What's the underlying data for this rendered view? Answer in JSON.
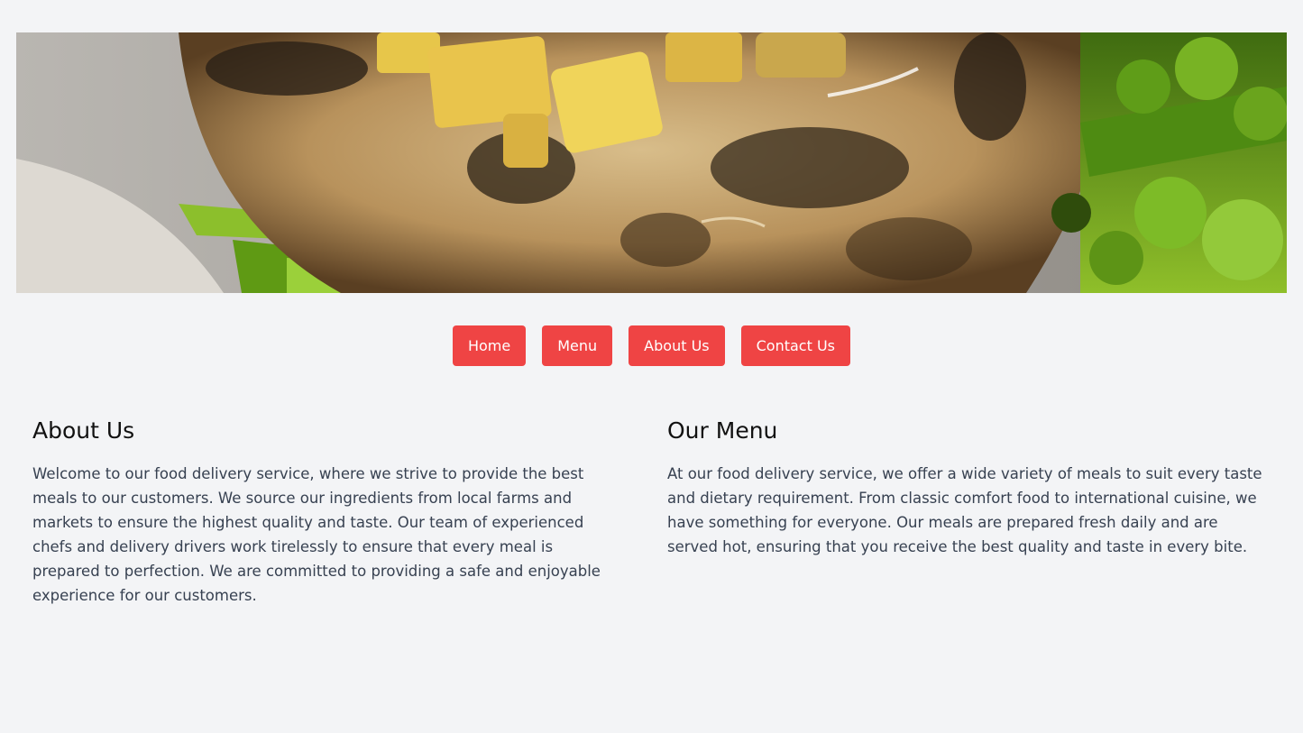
{
  "hero": {
    "image_name": "hero-food-image",
    "colors": {
      "plate": "#d9d4c9",
      "meat": "#c9a571",
      "char": "#2b2116",
      "apple": "#e7c64a",
      "greens": "#6f9e1c"
    }
  },
  "nav": {
    "accent": "#ef4444",
    "items": [
      {
        "label": "Home"
      },
      {
        "label": "Menu"
      },
      {
        "label": "About Us"
      },
      {
        "label": "Contact Us"
      }
    ]
  },
  "about": {
    "title": "About Us",
    "body": "Welcome to our food delivery service, where we strive to provide the best meals to our customers. We source our ingredients from local farms and markets to ensure the highest quality and taste. Our team of experienced chefs and delivery drivers work tirelessly to ensure that every meal is prepared to perfection. We are committed to providing a safe and enjoyable experience for our customers."
  },
  "menu": {
    "title": "Our Menu",
    "body": "At our food delivery service, we offer a wide variety of meals to suit every taste and dietary requirement. From classic comfort food to international cuisine, we have something for everyone. Our meals are prepared fresh daily and are served hot, ensuring that you receive the best quality and taste in every bite."
  }
}
